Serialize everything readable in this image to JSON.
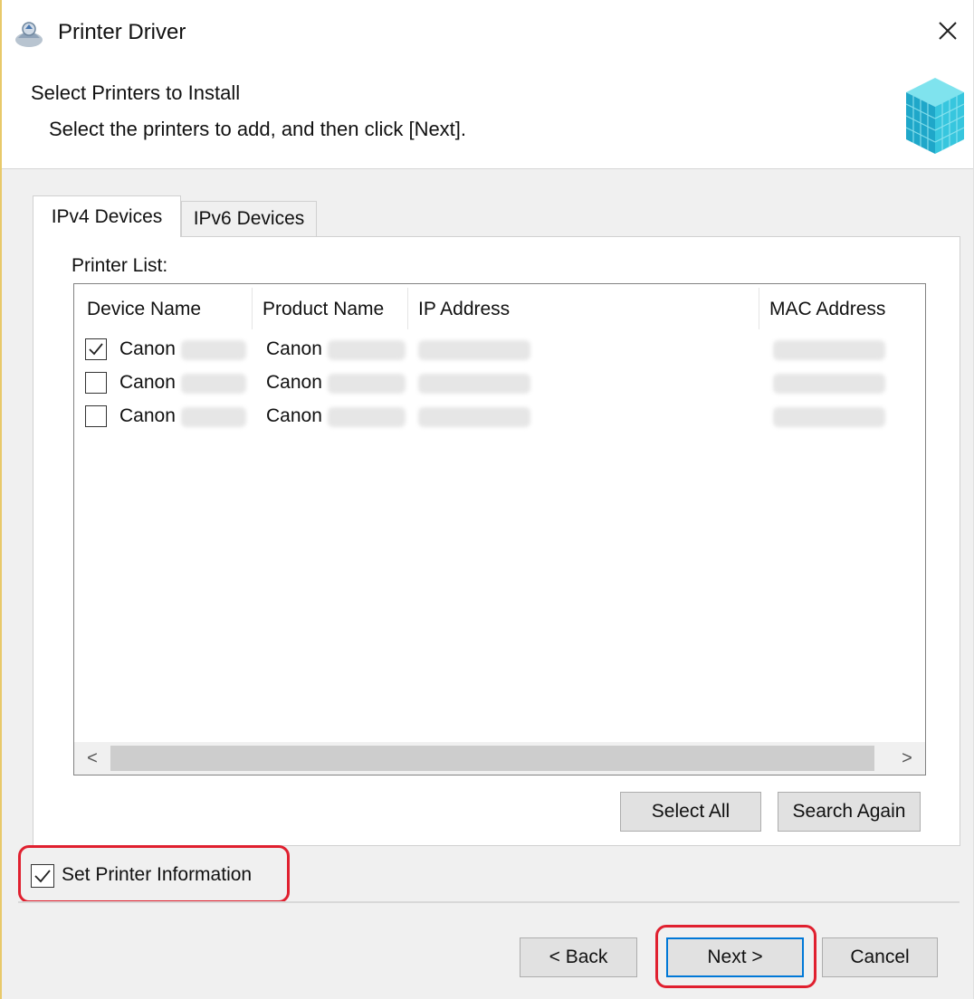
{
  "window": {
    "title": "Printer Driver"
  },
  "header": {
    "title": "Select Printers to Install",
    "subtitle": "Select the printers to add, and then click [Next]."
  },
  "tabs": [
    {
      "label": "IPv4 Devices",
      "active": true
    },
    {
      "label": "IPv6 Devices",
      "active": false
    }
  ],
  "printer_list": {
    "label": "Printer List:",
    "columns": [
      "Device Name",
      "Product Name",
      "IP Address",
      "MAC Address"
    ],
    "rows": [
      {
        "checked": true,
        "device": "Canon",
        "product": "Canon"
      },
      {
        "checked": false,
        "device": "Canon",
        "product": "Canon"
      },
      {
        "checked": false,
        "device": "Canon",
        "product": "Canon"
      }
    ],
    "scroll_left": "<",
    "scroll_right": ">"
  },
  "buttons": {
    "select_all": "Select All",
    "search_again": "Search Again",
    "back": "< Back",
    "next": "Next >",
    "cancel": "Cancel"
  },
  "set_printer_info": {
    "label": "Set Printer Information",
    "checked": true
  },
  "colors": {
    "highlight": "#e0202f",
    "accent": "#0078d7"
  },
  "icons": {
    "app": "printer-driver-icon",
    "close": "close-icon",
    "header": "cubes-icon"
  }
}
